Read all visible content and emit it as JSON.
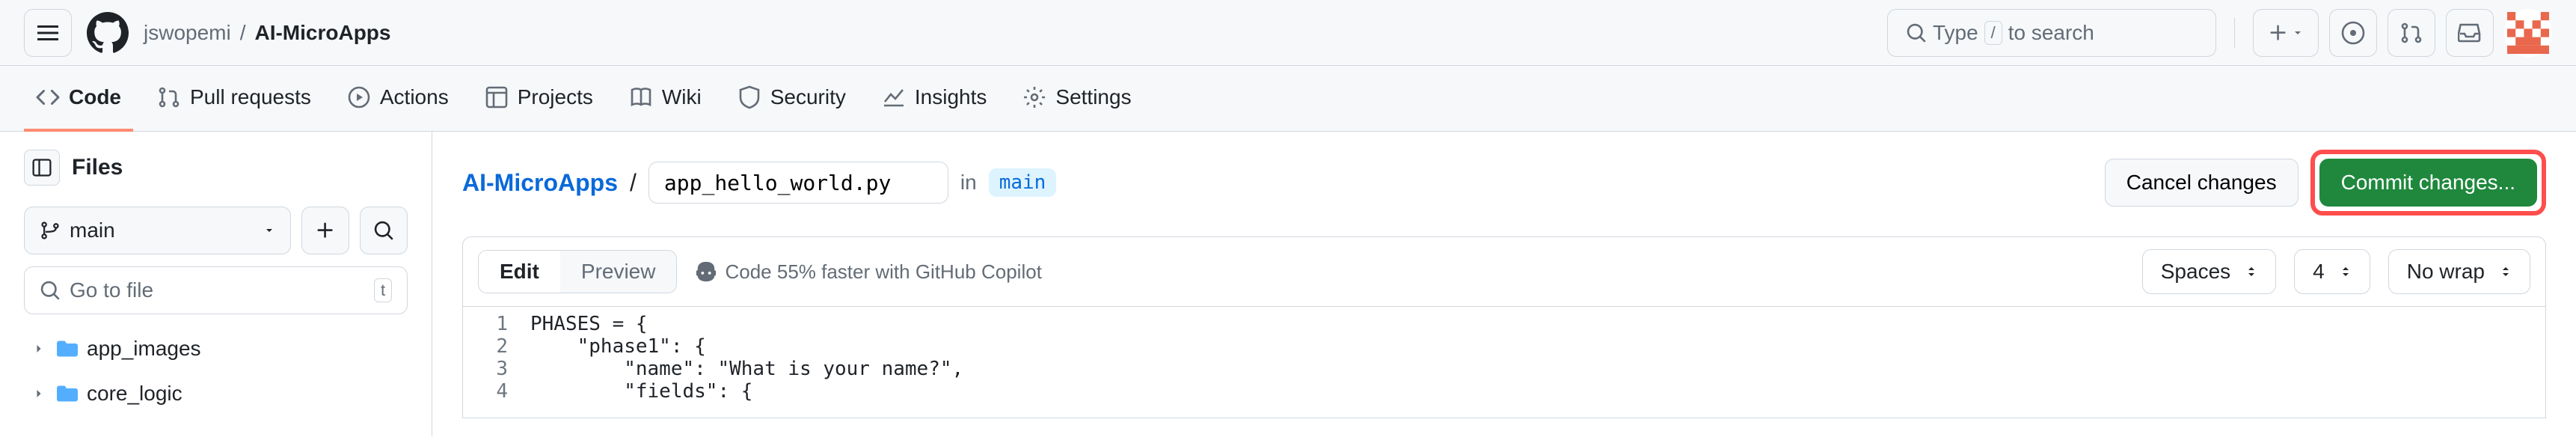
{
  "header": {
    "owner": "jswopemi",
    "repo": "AI-MicroApps",
    "search_placeholder": "Type",
    "search_suffix": "to search",
    "search_kbd": "/"
  },
  "nav": {
    "items": [
      {
        "label": "Code",
        "active": true
      },
      {
        "label": "Pull requests",
        "active": false
      },
      {
        "label": "Actions",
        "active": false
      },
      {
        "label": "Projects",
        "active": false
      },
      {
        "label": "Wiki",
        "active": false
      },
      {
        "label": "Security",
        "active": false
      },
      {
        "label": "Insights",
        "active": false
      },
      {
        "label": "Settings",
        "active": false
      }
    ]
  },
  "sidebar": {
    "title": "Files",
    "branch": "main",
    "filter_placeholder": "Go to file",
    "filter_kbd": "t",
    "tree": [
      {
        "name": "app_images"
      },
      {
        "name": "core_logic"
      }
    ]
  },
  "path": {
    "repo": "AI-MicroApps",
    "filename": "app_hello_world.py",
    "in": "in",
    "branch": "main",
    "cancel": "Cancel changes",
    "commit": "Commit changes..."
  },
  "toolbar": {
    "edit": "Edit",
    "preview": "Preview",
    "copilot": "Code 55% faster with GitHub Copilot",
    "indent_mode": "Spaces",
    "indent_size": "4",
    "wrap": "No wrap"
  },
  "code": {
    "lines": [
      {
        "no": "1",
        "text": "PHASES = {"
      },
      {
        "no": "2",
        "text": "    \"phase1\": {"
      },
      {
        "no": "3",
        "text": "        \"name\": \"What is your name?\","
      },
      {
        "no": "4",
        "text": "        \"fields\": {"
      }
    ]
  }
}
